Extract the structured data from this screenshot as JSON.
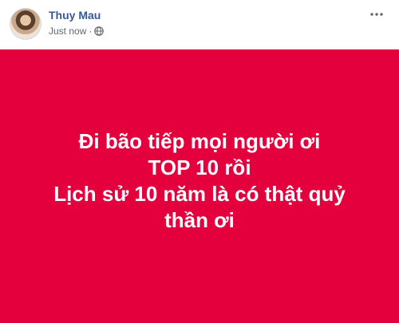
{
  "post": {
    "author_name": "Thuy Mau",
    "timestamp": "Just now",
    "separator": "·",
    "privacy_icon": "globe-icon",
    "more_icon": "more-horizontal-icon",
    "background_color": "#e4003d",
    "text_color": "#ffffff",
    "lines": [
      "Đi bão tiếp mọi người ơi",
      "TOP 10 rồi",
      "Lịch sử 10 năm là có thật quỷ",
      "thần ơi"
    ]
  }
}
